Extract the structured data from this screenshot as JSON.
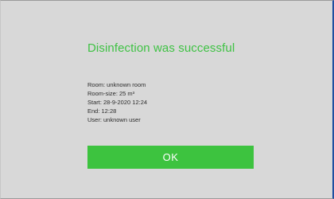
{
  "dialog": {
    "title": "Disinfection was successful",
    "details": [
      "Room: unknown room",
      "Room-size: 25 m³",
      "Start: 28-9-2020 12:24",
      "End: 12:28",
      "User: unknown user"
    ],
    "ok_label": "OK"
  },
  "colors": {
    "accent_green": "#3dc33f",
    "background": "#d8d8d8",
    "border_blue": "#1f4fa0"
  }
}
